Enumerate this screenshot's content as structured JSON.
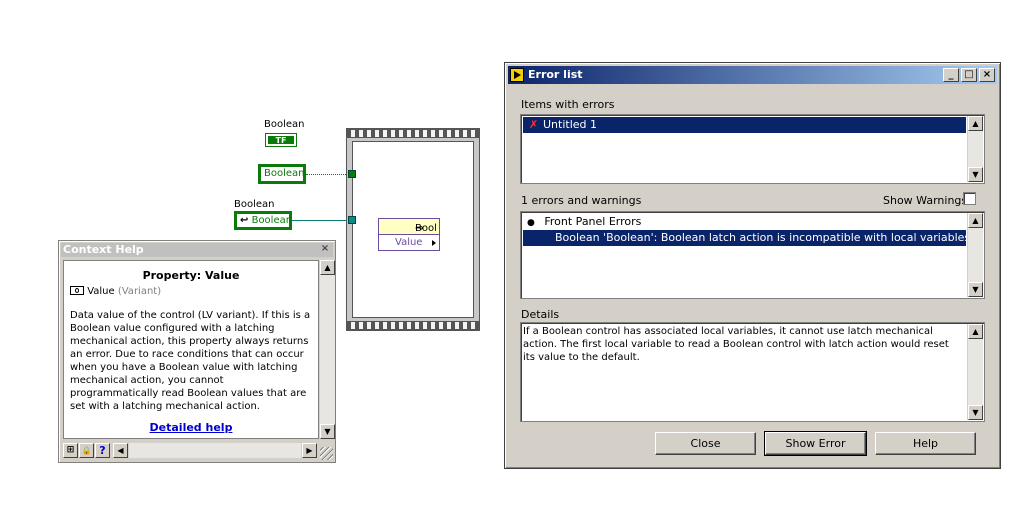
{
  "block_diagram": {
    "boolean_label_top": "Boolean",
    "tf_glyph": "TF",
    "boolean_terminal": "Boolean",
    "boolean_label_local": "Boolean",
    "local_var_label": "Boolean",
    "property_node": {
      "class_label": "Bool",
      "property_label": "Value"
    }
  },
  "context_help": {
    "title": "Context Help",
    "close_glyph": "×",
    "heading": "Property: Value",
    "value_name": "Value",
    "value_type": "(Variant)",
    "description": "Data value of the control (LV variant). If this is a Boolean value configured with a latching mechanical action, this property always returns an error. Due to race conditions that can occur when you have a Boolean value with latching mechanical action, you cannot programmatically read Boolean values that are set with a latching mechanical action.",
    "detailed_help_link": "Detailed help",
    "tools": [
      "⊞",
      "🔒",
      "?"
    ]
  },
  "error_list": {
    "title": "Error list",
    "min_glyph": "_",
    "max_glyph": "□",
    "close_glyph": "×",
    "items_label": "Items with errors",
    "items": [
      {
        "icon": "x-icon",
        "label": "Untitled 1"
      }
    ],
    "count_label": "1 errors and warnings",
    "show_warnings_label": "Show Warnings",
    "show_warnings_checked": false,
    "errors_group": "Front Panel Errors",
    "errors": [
      "Boolean 'Boolean': Boolean latch action is incompatible with local variables"
    ],
    "details_label": "Details",
    "details_text": "If a Boolean control has associated local variables, it cannot use latch mechanical action. The first local variable to read a Boolean control with latch action would reset its value to the default.",
    "buttons": {
      "close": "Close",
      "show_error": "Show Error",
      "help": "Help"
    }
  },
  "colors": {
    "boolean_green": "#0a7a0a",
    "property_purple": "#6a4b9c",
    "selection_navy": "#0a246a",
    "dialog_gray": "#d4d0c8"
  }
}
